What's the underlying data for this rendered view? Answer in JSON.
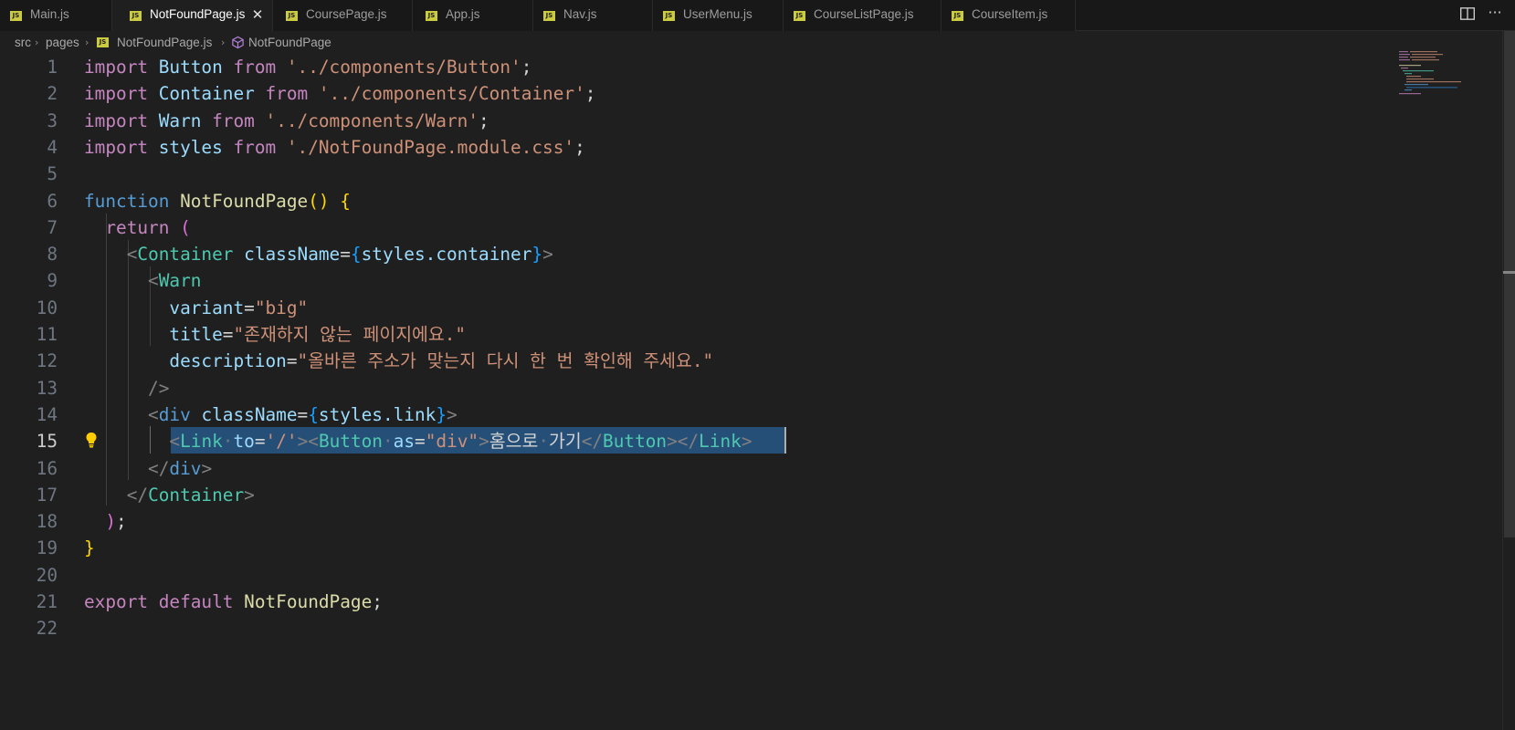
{
  "tabs": [
    {
      "label": "Main.js",
      "active": false
    },
    {
      "label": "NotFoundPage.js",
      "active": true
    },
    {
      "label": "CoursePage.js",
      "active": false
    },
    {
      "label": "App.js",
      "active": false
    },
    {
      "label": "Nav.js",
      "active": false
    },
    {
      "label": "UserMenu.js",
      "active": false
    },
    {
      "label": "CourseListPage.js",
      "active": false
    },
    {
      "label": "CourseItem.js",
      "active": false
    }
  ],
  "tab_icon_text": "JS",
  "close_glyph": "✕",
  "more_actions_glyph": "···",
  "icons": {
    "file_icon": "js-file-icon",
    "split": "split-editor-icon",
    "more": "more-actions-icon",
    "symbol": "component-symbol-icon",
    "lightbulb": "lightbulb-icon"
  },
  "breadcrumb": {
    "items": [
      "src",
      "pages",
      "NotFoundPage.js",
      "NotFoundPage"
    ],
    "separator": "›"
  },
  "editor": {
    "current_line": 15,
    "line_numbers": [
      "1",
      "2",
      "3",
      "4",
      "5",
      "6",
      "7",
      "8",
      "9",
      "10",
      "11",
      "12",
      "13",
      "14",
      "15",
      "16",
      "17",
      "18",
      "19",
      "20",
      "21",
      "22"
    ],
    "lines": {
      "l1": {
        "kw": "import",
        "name": "Button",
        "from": "from",
        "str": "'../components/Button'",
        "end": ";"
      },
      "l2": {
        "kw": "import",
        "name": "Container",
        "from": "from",
        "str": "'../components/Container'",
        "end": ";"
      },
      "l3": {
        "kw": "import",
        "name": "Warn",
        "from": "from",
        "str": "'../components/Warn'",
        "end": ";"
      },
      "l4": {
        "kw": "import",
        "name": "styles",
        "from": "from",
        "str": "'./NotFoundPage.module.css'",
        "end": ";"
      },
      "l6": {
        "kw": "function",
        "name": "NotFoundPage",
        "parens": "()",
        "brace": "{"
      },
      "l7": {
        "kw": "return",
        "paren": "("
      },
      "l8": {
        "lt": "<",
        "tag": "Container",
        "attr": "className",
        "eq": "=",
        "ob": "{",
        "expr": "styles.container",
        "cb": "}",
        "gt": ">"
      },
      "l9": {
        "lt": "<",
        "tag": "Warn"
      },
      "l10": {
        "attr": "variant",
        "eq": "=",
        "str": "\"big\""
      },
      "l11": {
        "attr": "title",
        "eq": "=",
        "str": "\"존재하지 않는 페이지에요.\""
      },
      "l12": {
        "attr": "description",
        "eq": "=",
        "str": "\"올바른 주소가 맞는지 다시 한 번 확인해 주세요.\""
      },
      "l13": {
        "close": "/>"
      },
      "l14": {
        "lt": "<",
        "tag": "div",
        "attr": "className",
        "eq": "=",
        "ob": "{",
        "expr": "styles.link",
        "cb": "}",
        "gt": ">"
      },
      "l15": {
        "lt": "<",
        "tag_link": "Link",
        "dot1": "·",
        "attr_to": "to",
        "eq": "=",
        "str_to": "'/'",
        "gt": ">",
        "lt2": "<",
        "tag_button": "Button",
        "dot2": "·",
        "attr_as": "as",
        "eq2": "=",
        "str_as": "\"div\"",
        "gt2": ">",
        "text1": "홈으로",
        "dot3": "·",
        "text2": "가기",
        "close_button_lt": "</",
        "close_button": "Button",
        "close_button_gt": ">",
        "close_link_lt": "</",
        "close_link": "Link",
        "close_link_gt": ">"
      },
      "l16": {
        "lt": "</",
        "tag": "div",
        "gt": ">"
      },
      "l17": {
        "lt": "</",
        "tag": "Container",
        "gt": ">"
      },
      "l18": {
        "paren": ")",
        "end": ";"
      },
      "l19": {
        "brace": "}"
      },
      "l21": {
        "kw1": "export",
        "kw2": "default",
        "name": "NotFoundPage",
        "end": ";"
      }
    }
  },
  "colors": {
    "background": "#1f1f1f",
    "tab_bar": "#181818",
    "selection": "#264f78",
    "keyword": "#c586c0",
    "string": "#ce9178",
    "jsx_tag": "#4ec9b0",
    "js_icon": "#cbcb41"
  }
}
